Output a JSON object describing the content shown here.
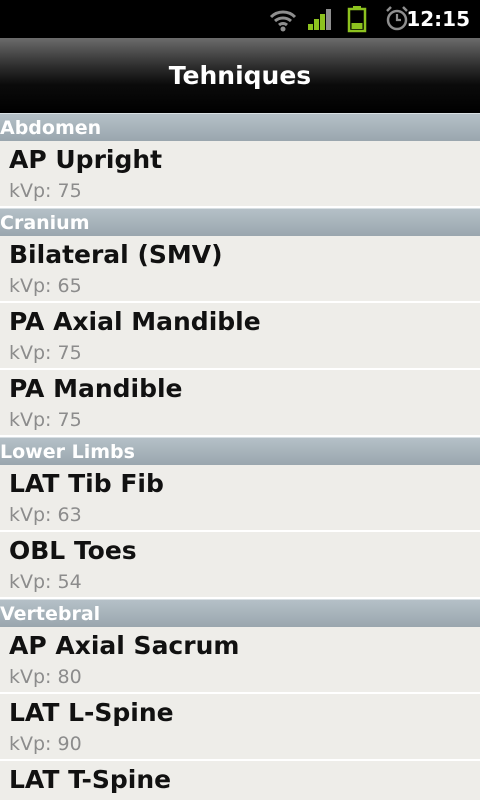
{
  "status_bar": {
    "time": "12:15",
    "icons": [
      "wifi-icon",
      "signal-icon",
      "battery-icon",
      "alarm-icon"
    ]
  },
  "title": "Tehniques",
  "sections": [
    {
      "header": "Abdomen",
      "items": [
        {
          "title": "AP Upright",
          "subtitle": "kVp: 75"
        }
      ]
    },
    {
      "header": "Cranium",
      "items": [
        {
          "title": "Bilateral (SMV)",
          "subtitle": "kVp: 65"
        },
        {
          "title": "PA Axial Mandible",
          "subtitle": "kVp: 75"
        },
        {
          "title": "PA Mandible",
          "subtitle": "kVp: 75"
        }
      ]
    },
    {
      "header": "Lower Limbs",
      "items": [
        {
          "title": "LAT Tib Fib",
          "subtitle": "kVp: 63"
        },
        {
          "title": "OBL Toes",
          "subtitle": "kVp: 54"
        }
      ]
    },
    {
      "header": "Vertebral",
      "items": [
        {
          "title": "AP Axial Sacrum",
          "subtitle": "kVp: 80"
        },
        {
          "title": "LAT L-Spine",
          "subtitle": "kVp: 90"
        },
        {
          "title": "LAT T-Spine",
          "subtitle": ""
        }
      ]
    }
  ],
  "colors": {
    "status_icons": "#8dc21f",
    "section_header": "#a5b0b8",
    "row_background": "#eeede9"
  }
}
